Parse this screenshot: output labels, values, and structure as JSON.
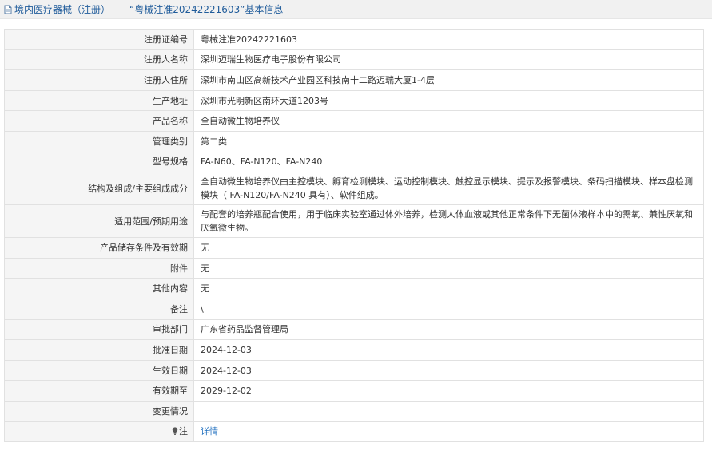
{
  "header": {
    "title": "境内医疗器械（注册）——“粤械注准20242221603”基本信息"
  },
  "rows": [
    {
      "label": "注册证编号",
      "value": "粤械注准20242221603"
    },
    {
      "label": "注册人名称",
      "value": "深圳迈瑞生物医疗电子股份有限公司"
    },
    {
      "label": "注册人住所",
      "value": "深圳市南山区高新技术产业园区科技南十二路迈瑞大厦1-4层"
    },
    {
      "label": "生产地址",
      "value": "深圳市光明新区南环大道1203号"
    },
    {
      "label": "产品名称",
      "value": "全自动微生物培养仪"
    },
    {
      "label": "管理类别",
      "value": "第二类"
    },
    {
      "label": "型号规格",
      "value": "FA-N60、FA-N120、FA-N240"
    },
    {
      "label": "结构及组成/主要组成成分",
      "value": "全自动微生物培养仪由主控模块、孵育检测模块、运动控制模块、触控显示模块、提示及报警模块、条码扫描模块、样本盘检测模块（ FA-N120/FA-N240 具有）、软件组成。"
    },
    {
      "label": "适用范围/预期用途",
      "value": "与配套的培养瓶配合使用，用于临床实验室通过体外培养，检测人体血液或其他正常条件下无菌体液样本中的需氧、兼性厌氧和厌氧微生物。"
    },
    {
      "label": "产品储存条件及有效期",
      "value": "无"
    },
    {
      "label": "附件",
      "value": "无"
    },
    {
      "label": "其他内容",
      "value": "无"
    },
    {
      "label": "备注",
      "value": "\\"
    },
    {
      "label": "审批部门",
      "value": "广东省药品监督管理局"
    },
    {
      "label": "批准日期",
      "value": "2024-12-03"
    },
    {
      "label": "生效日期",
      "value": "2024-12-03"
    },
    {
      "label": "有效期至",
      "value": "2029-12-02"
    },
    {
      "label": "变更情况",
      "value": ""
    }
  ],
  "note_row": {
    "label": "注",
    "icon": "lightbulb-icon",
    "link": "详情"
  },
  "colors": {
    "header_text": "#1f5b9a",
    "link": "#1f6fbf",
    "label_bg": "#f5f5f5",
    "border": "#e1e1e1"
  }
}
